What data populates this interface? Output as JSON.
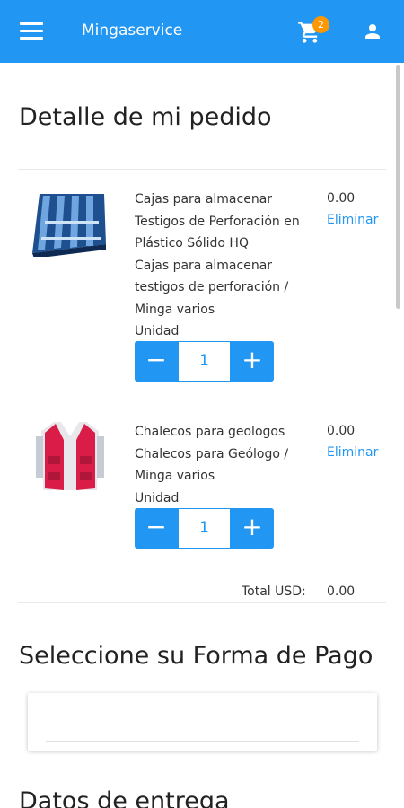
{
  "appbar": {
    "title": "Mingaservice",
    "cart_count": "2",
    "color": "#2196f3",
    "badge_color": "#ff9800"
  },
  "order": {
    "heading": "Detalle de mi pedido",
    "items": [
      {
        "image": "core-box-icon",
        "description_lines": [
          "Cajas para almacenar",
          "Testigos de Perforación en",
          "Plástico Sólido HQ",
          "Cajas para almacenar",
          "testigos de perforación /",
          "Minga varios",
          "Unidad"
        ],
        "price": "0.00",
        "remove_label": "Eliminar",
        "quantity": "1"
      },
      {
        "image": "vest-icon",
        "description_lines": [
          "Chalecos para geologos",
          "Chalecos para Geólogo /",
          "Minga varios",
          "Unidad"
        ],
        "price": "0.00",
        "remove_label": "Eliminar",
        "quantity": "1"
      }
    ],
    "total_label": "Total USD:",
    "total_value": "0.00"
  },
  "payment": {
    "heading": "Seleccione su Forma de Pago"
  },
  "delivery": {
    "heading": "Datos de entrega"
  }
}
